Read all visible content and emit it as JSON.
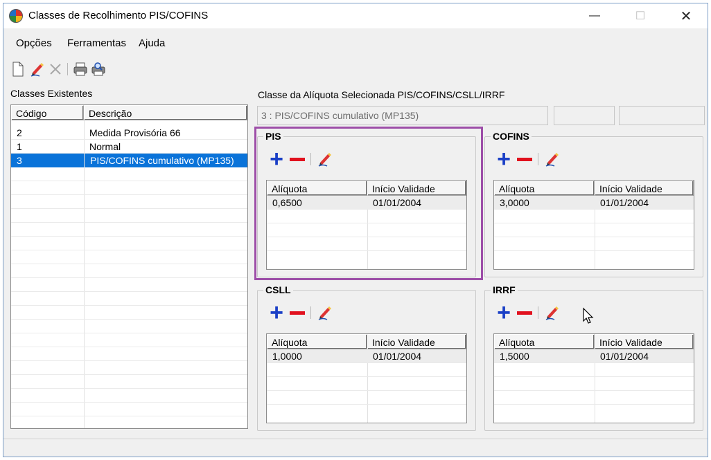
{
  "window": {
    "title": "Classes de Recolhimento PIS/COFINS",
    "minimize": "—",
    "maximize": "☐",
    "close": "✕"
  },
  "menu": [
    "Opções",
    "Ferramentas",
    "Ajuda"
  ],
  "toolbar": {
    "icons": [
      "new-document-icon",
      "edit-pencil-icon",
      "delete-x-icon",
      "print-icon",
      "print-preview-icon"
    ]
  },
  "left": {
    "label": "Classes Existentes",
    "columns": [
      "Código",
      "Descrição"
    ],
    "rows": [
      {
        "code": "2",
        "desc": "Medida Provisória 66"
      },
      {
        "code": "1",
        "desc": "Normal"
      },
      {
        "code": "3",
        "desc": "PIS/COFINS cumulativo (MP135)"
      }
    ],
    "selected_index": 2
  },
  "right": {
    "label": "Classe da Alíquota Selecionada PIS/COFINS/CSLL/IRRF",
    "selected_value": "3 : PIS/COFINS cumulativo (MP135)",
    "extra1": "",
    "extra2": ""
  },
  "groups": [
    {
      "title": "PIS",
      "columns": [
        "Alíquota",
        "Início Validade"
      ],
      "rows": [
        {
          "aliquota": "0,6500",
          "inicio": "01/01/2004"
        }
      ]
    },
    {
      "title": "COFINS",
      "columns": [
        "Alíquota",
        "Início Validade"
      ],
      "rows": [
        {
          "aliquota": "3,0000",
          "inicio": "01/01/2004"
        }
      ]
    },
    {
      "title": "CSLL",
      "columns": [
        "Alíquota",
        "Início Validade"
      ],
      "rows": [
        {
          "aliquota": "1,0000",
          "inicio": "01/01/2004"
        }
      ]
    },
    {
      "title": "IRRF",
      "columns": [
        "Alíquota",
        "Início Validade"
      ],
      "rows": [
        {
          "aliquota": "1,5000",
          "inicio": "01/01/2004"
        }
      ]
    }
  ],
  "colors": {
    "selection": "#0a73d9",
    "plus": "#1a3fc6",
    "minus": "#e1111e",
    "highlight": "#9d4ea8"
  }
}
